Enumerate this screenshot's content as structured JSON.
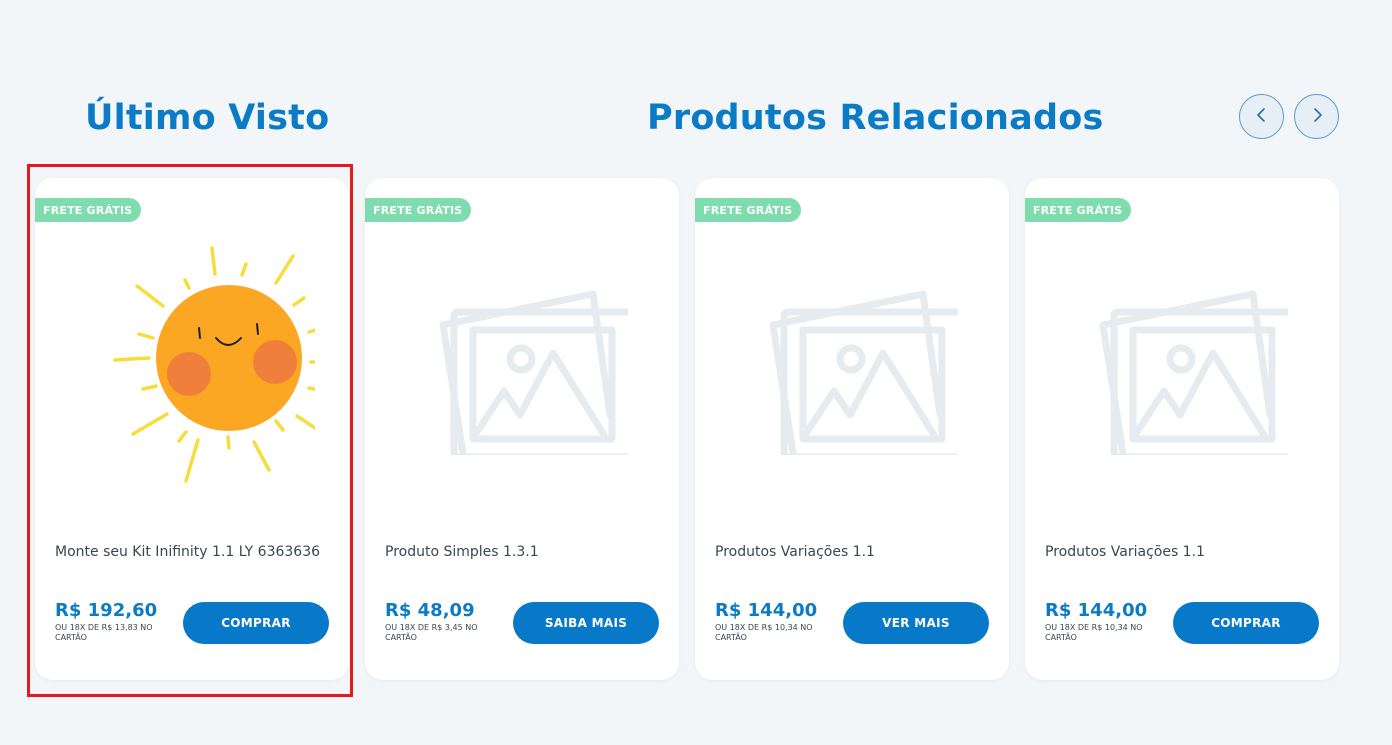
{
  "sections": {
    "last_seen_title": "Último Visto",
    "related_title": "Produtos Relacionados"
  },
  "carousel": {
    "prev_icon": "chevron-left-icon",
    "next_icon": "chevron-right-icon"
  },
  "colors": {
    "brand_blue": "#0c7bc5",
    "button_blue": "#0878c8",
    "badge_green": "#7fdcae",
    "highlight_red": "#e31b1b"
  },
  "products": [
    {
      "badge": "FRETE GRÁTIS",
      "image": "sun-illustration",
      "title": "Monte seu Kit Inifinity 1.1 LY 6363636",
      "price": "R$ 192,60",
      "installments": "OU 18X DE R$ 13,83 NO CARTÃO",
      "button": "COMPRAR"
    },
    {
      "badge": "FRETE GRÁTIS",
      "image": "image-placeholder-icon",
      "title": "Produto Simples 1.3.1",
      "price": "R$ 48,09",
      "installments": "OU 18X DE R$ 3,45 NO CARTÃO",
      "button": "SAIBA MAIS"
    },
    {
      "badge": "FRETE GRÁTIS",
      "image": "image-placeholder-icon",
      "title": "Produtos Variações 1.1",
      "price": "R$ 144,00",
      "installments": "OU 18X DE R$ 10,34 NO CARTÃO",
      "button": "VER MAIS"
    },
    {
      "badge": "FRETE GRÁTIS",
      "image": "image-placeholder-icon",
      "title": "Produtos Variações 1.1",
      "price": "R$ 144,00",
      "installments": "OU 18X DE R$ 10,34 NO CARTÃO",
      "button": "COMPRAR"
    }
  ]
}
